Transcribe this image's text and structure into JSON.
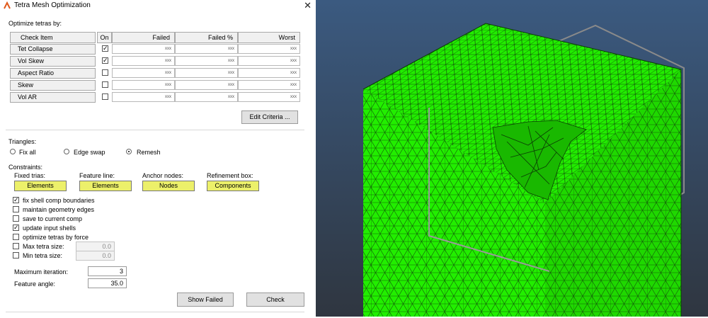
{
  "window": {
    "title": "Tetra Mesh Optimization",
    "close_icon": "close-icon"
  },
  "optimize": {
    "section_label": "Optimize tetras by:",
    "columns": [
      "Check Item",
      "On",
      "Failed",
      "Failed %",
      "Worst"
    ],
    "rows": [
      {
        "label": "Tet Collapse",
        "on": true,
        "failed": "xxx",
        "failed_pct": "xxx",
        "worst": "xxx"
      },
      {
        "label": "Vol Skew",
        "on": true,
        "failed": "xxx",
        "failed_pct": "xxx",
        "worst": "xxx"
      },
      {
        "label": "Aspect Ratio",
        "on": false,
        "failed": "xxx",
        "failed_pct": "xxx",
        "worst": "xxx"
      },
      {
        "label": "Skew",
        "on": false,
        "failed": "xxx",
        "failed_pct": "xxx",
        "worst": "xxx"
      },
      {
        "label": "Vol AR",
        "on": false,
        "failed": "xxx",
        "failed_pct": "xxx",
        "worst": "xxx"
      }
    ],
    "edit_criteria_label": "Edit Criteria ..."
  },
  "triangles": {
    "label": "Triangles:",
    "options": [
      {
        "label": "Fix all",
        "selected": false
      },
      {
        "label": "Edge swap",
        "selected": false
      },
      {
        "label": "Remesh",
        "selected": true
      }
    ]
  },
  "constraints": {
    "label": "Constraints:",
    "selectors": [
      {
        "caption": "Fixed trias:",
        "button": "Elements"
      },
      {
        "caption": "Feature line:",
        "button": "Elements"
      },
      {
        "caption": "Anchor nodes:",
        "button": "Nodes"
      },
      {
        "caption": "Refinement box:",
        "button": "Components"
      }
    ],
    "checks": [
      {
        "label": "fix shell comp boundaries",
        "checked": true
      },
      {
        "label": "maintain geometry edges",
        "checked": false
      },
      {
        "label": "save to current comp",
        "checked": false
      },
      {
        "label": "update input shells",
        "checked": true
      },
      {
        "label": "optimize tetras by force",
        "checked": false
      }
    ],
    "sizes": [
      {
        "label": "Max tetra size:",
        "checked": false,
        "value": "0.0"
      },
      {
        "label": "Min tetra size:",
        "checked": false,
        "value": "0.0"
      }
    ]
  },
  "params": {
    "max_iter_label": "Maximum iteration:",
    "max_iter_value": "3",
    "feature_angle_label": "Feature angle:",
    "feature_angle_value": "35.0"
  },
  "actions": {
    "show_failed": "Show Failed",
    "check": "Check"
  },
  "viewport": {
    "mesh_color": "#22ee00",
    "background_top": "#3b5a80",
    "background_bottom": "#2f3640"
  }
}
